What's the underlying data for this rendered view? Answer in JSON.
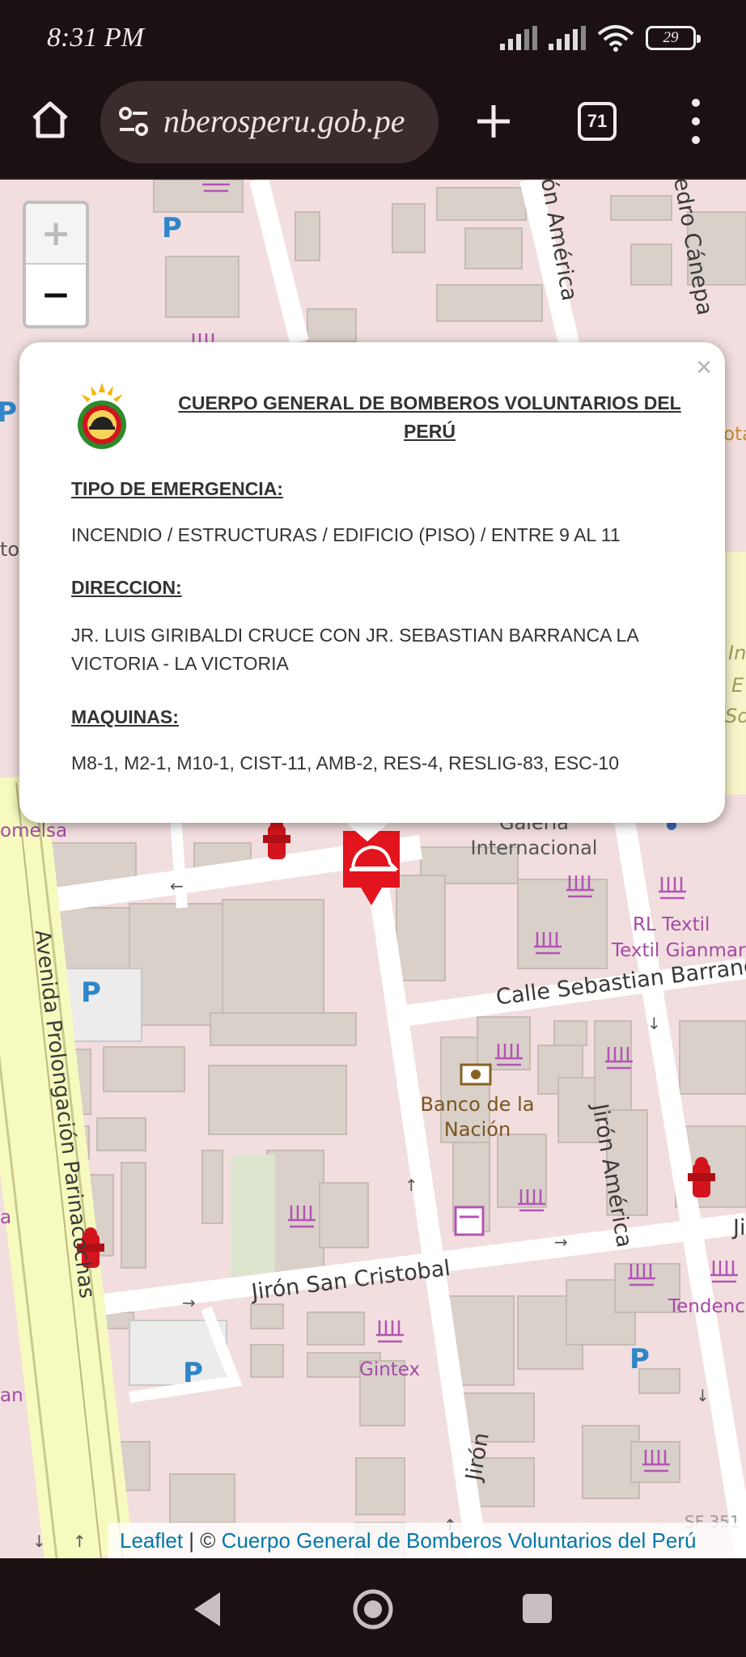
{
  "status": {
    "time": "8:31 PM",
    "battery": "29"
  },
  "browser": {
    "url": "nberosperu.gob.pe",
    "tab_count": "71"
  },
  "map": {
    "zoom_in": "+",
    "zoom_out": "−",
    "parking": "P",
    "labels": {
      "avenida": "Avenida Prolongación Parinacochas",
      "calle_sebastian": "Calle Sebastian Barranca",
      "jiron_america_top": "Jirón América",
      "jiron_america": "Jirón América",
      "pedro_canepa": "Pedro Cánepa",
      "jiron_san_cristobal": "Jirón San Cristobal",
      "jiron_bottom": "Jirón",
      "jiron_right": "Ji",
      "galeria": "Galería Internacional",
      "banco": "Banco de la Nación",
      "rl_textil": "RL Textil",
      "textil_gianmar": "Textil Gianmar",
      "tendencias": "Tendenc Olind",
      "gintex": "Gintex",
      "omelsa": "omelsa",
      "an": "an",
      "a": "a",
      "ota": "ota",
      "in": "In",
      "e": "E",
      "so": "So",
      "to": "to",
      "sf": "SF 351"
    }
  },
  "popup": {
    "close": "×",
    "title": "CUERPO GENERAL DE BOMBEROS VOLUNTARIOS DEL PERÚ",
    "tipo_label": "TIPO DE EMERGENCIA:",
    "tipo_value": "INCENDIO / ESTRUCTURAS / EDIFICIO (PISO) / ENTRE 9 AL 11",
    "direccion_label": "DIRECCION:",
    "direccion_value": "JR. LUIS GIRIBALDI CRUCE CON JR. SEBASTIAN BARRANCA LA VICTORIA - LA VICTORIA",
    "maquinas_label": "MAQUINAS:",
    "maquinas_value": "M8-1, M2-1, M10-1, CIST-11, AMB-2, RES-4, RESLIG-83, ESC-10"
  },
  "attribution": {
    "leaflet": "Leaflet",
    "sep": " | © ",
    "source": "Cuerpo General de Bomberos Voluntarios del Perú"
  },
  "colors": {
    "map_bg": "#f2dede",
    "road": "#ffffff",
    "building": "#d9d0c9",
    "avenue": "#f7fabf",
    "marker": "#e2141e"
  }
}
